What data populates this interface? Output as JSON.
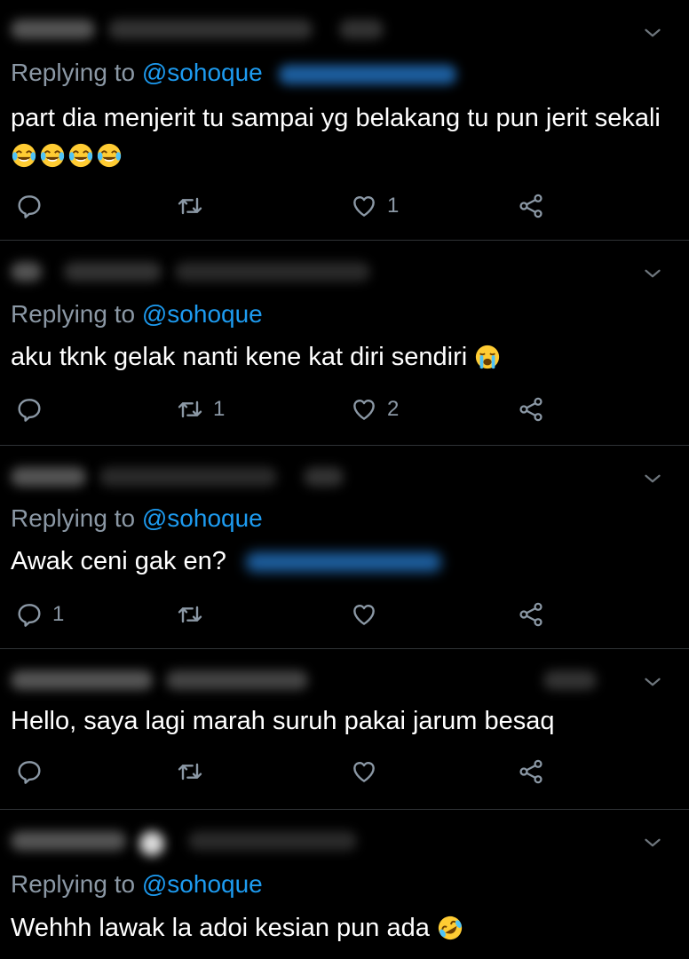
{
  "colors": {
    "background": "#000000",
    "text": "#ffffff",
    "muted": "#8b98a5",
    "link": "#1d9bf0",
    "divider": "#2f3336"
  },
  "icons": {
    "reply": "reply-icon",
    "retweet": "retweet-icon",
    "like": "heart-icon",
    "share": "share-icon",
    "menu": "chevron-down-icon"
  },
  "tweets": [
    {
      "replying_prefix": "Replying to",
      "replying_handle": "@sohoque",
      "text": "part dia menjerit tu sampai yg belakang tu pun jerit sekali",
      "emoji": "tears-of-joy x4",
      "reply_count": "",
      "retweet_count": "",
      "like_count": "1"
    },
    {
      "replying_prefix": "Replying to",
      "replying_handle": "@sohoque",
      "text": "aku tknk gelak nanti kene kat diri sendiri",
      "emoji": "loudly-crying",
      "reply_count": "",
      "retweet_count": "1",
      "like_count": "2"
    },
    {
      "replying_prefix": "Replying to",
      "replying_handle": "@sohoque",
      "text": "Awak ceni gak en?",
      "emoji": "",
      "reply_count": "1",
      "retweet_count": "",
      "like_count": ""
    },
    {
      "replying_prefix": "",
      "replying_handle": "",
      "text": "Hello, saya lagi marah suruh pakai jarum besaq",
      "emoji": "",
      "reply_count": "",
      "retweet_count": "",
      "like_count": ""
    },
    {
      "replying_prefix": "Replying to",
      "replying_handle": "@sohoque",
      "text": "Wehhh lawak la adoi kesian pun ada",
      "emoji": "rolling-on-floor-laughing",
      "reply_count": "",
      "retweet_count": "",
      "like_count": ""
    }
  ]
}
